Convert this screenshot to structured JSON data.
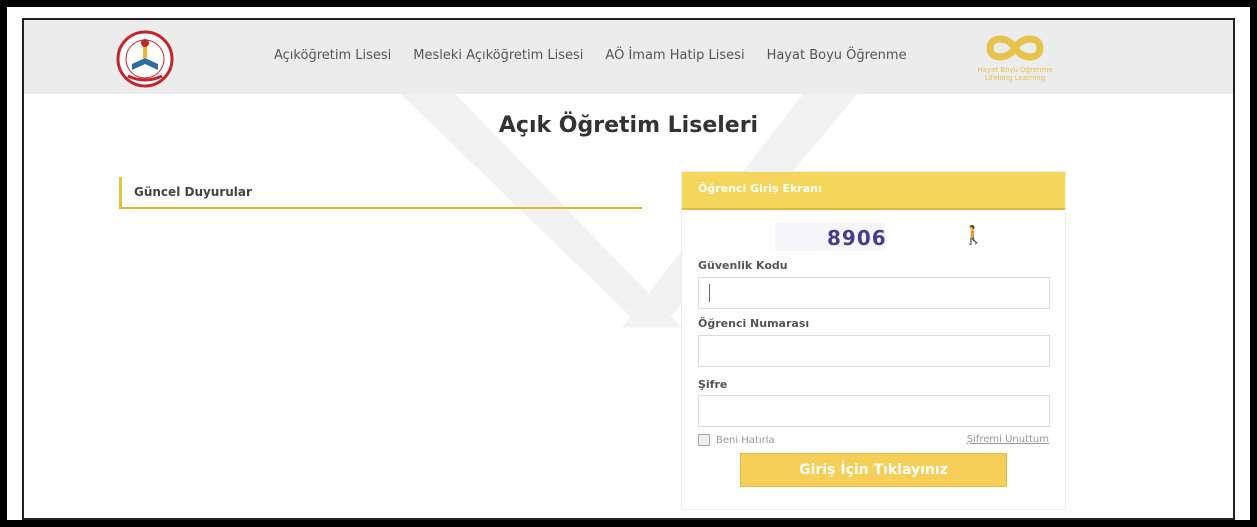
{
  "nav": {
    "items": [
      "Açıköğretim Lisesi",
      "Mesleki Açıköğretim Lisesi",
      "AÖ İmam Hatip Lisesi",
      "Hayat Boyu Öğrenme"
    ]
  },
  "logo_right": {
    "line1": "Hayat Boyu Öğrenme",
    "line2": "Lifelong Learning"
  },
  "page": {
    "title": "Açık Öğretim Liseleri"
  },
  "news": {
    "title": "Güncel Duyurular"
  },
  "login": {
    "title": "Öğrenci Giriş Ekranı",
    "captcha": "8906",
    "security_label": "Güvenlik Kodu",
    "student_label": "Öğrenci Numarası",
    "password_label": "Şifre",
    "remember_label": "Beni Hatırla",
    "forgot_label": "Şifremi Unuttum",
    "submit_label": "Giriş İçin Tıklayınız"
  },
  "colors": {
    "accent": "#f4d65a",
    "accent_dark": "#e0b938"
  }
}
